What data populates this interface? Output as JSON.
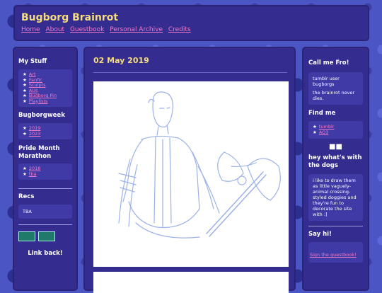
{
  "header": {
    "title": "Bugborg Brainrot",
    "nav": [
      "Home",
      "About",
      "Guestbook",
      "Personal Archive",
      "Credits"
    ]
  },
  "left": {
    "mystuff": {
      "title": "My Stuff",
      "items": [
        "Art",
        "Fanfic",
        "Sculpts",
        "AUs",
        "Bugborg Pin",
        "Playlists"
      ]
    },
    "week": {
      "title": "Bugborgweek",
      "items": [
        "2019",
        "2023"
      ]
    },
    "pride": {
      "title": "Pride Month Marathon",
      "items": [
        "2018",
        "tba"
      ]
    },
    "recs": {
      "title": "Recs",
      "text": "TBA"
    },
    "linkback": "Link back!"
  },
  "main": {
    "date": "02 May 2019"
  },
  "right": {
    "callme": {
      "title": "Call me Fro!",
      "text1": "tumblr user bugborgs",
      "text2": "the brainrot never dies."
    },
    "findme": {
      "title": "Find me",
      "items": [
        "tumblr",
        "AO3"
      ]
    },
    "dogs": {
      "title": "hey what's with the dogs",
      "text": "i like to draw them as little vaguely-animal crossing-styled doggies and they're fun to decorate the site with :]"
    },
    "sayhi": {
      "title": "Say hi!",
      "link": "Sign the guestbook!"
    }
  },
  "colors": {
    "panel": "#342c8e",
    "inner": "#3f3aa6",
    "title": "#f6dc79",
    "link": "#f07ac8",
    "sketch": "#9db2e6"
  }
}
